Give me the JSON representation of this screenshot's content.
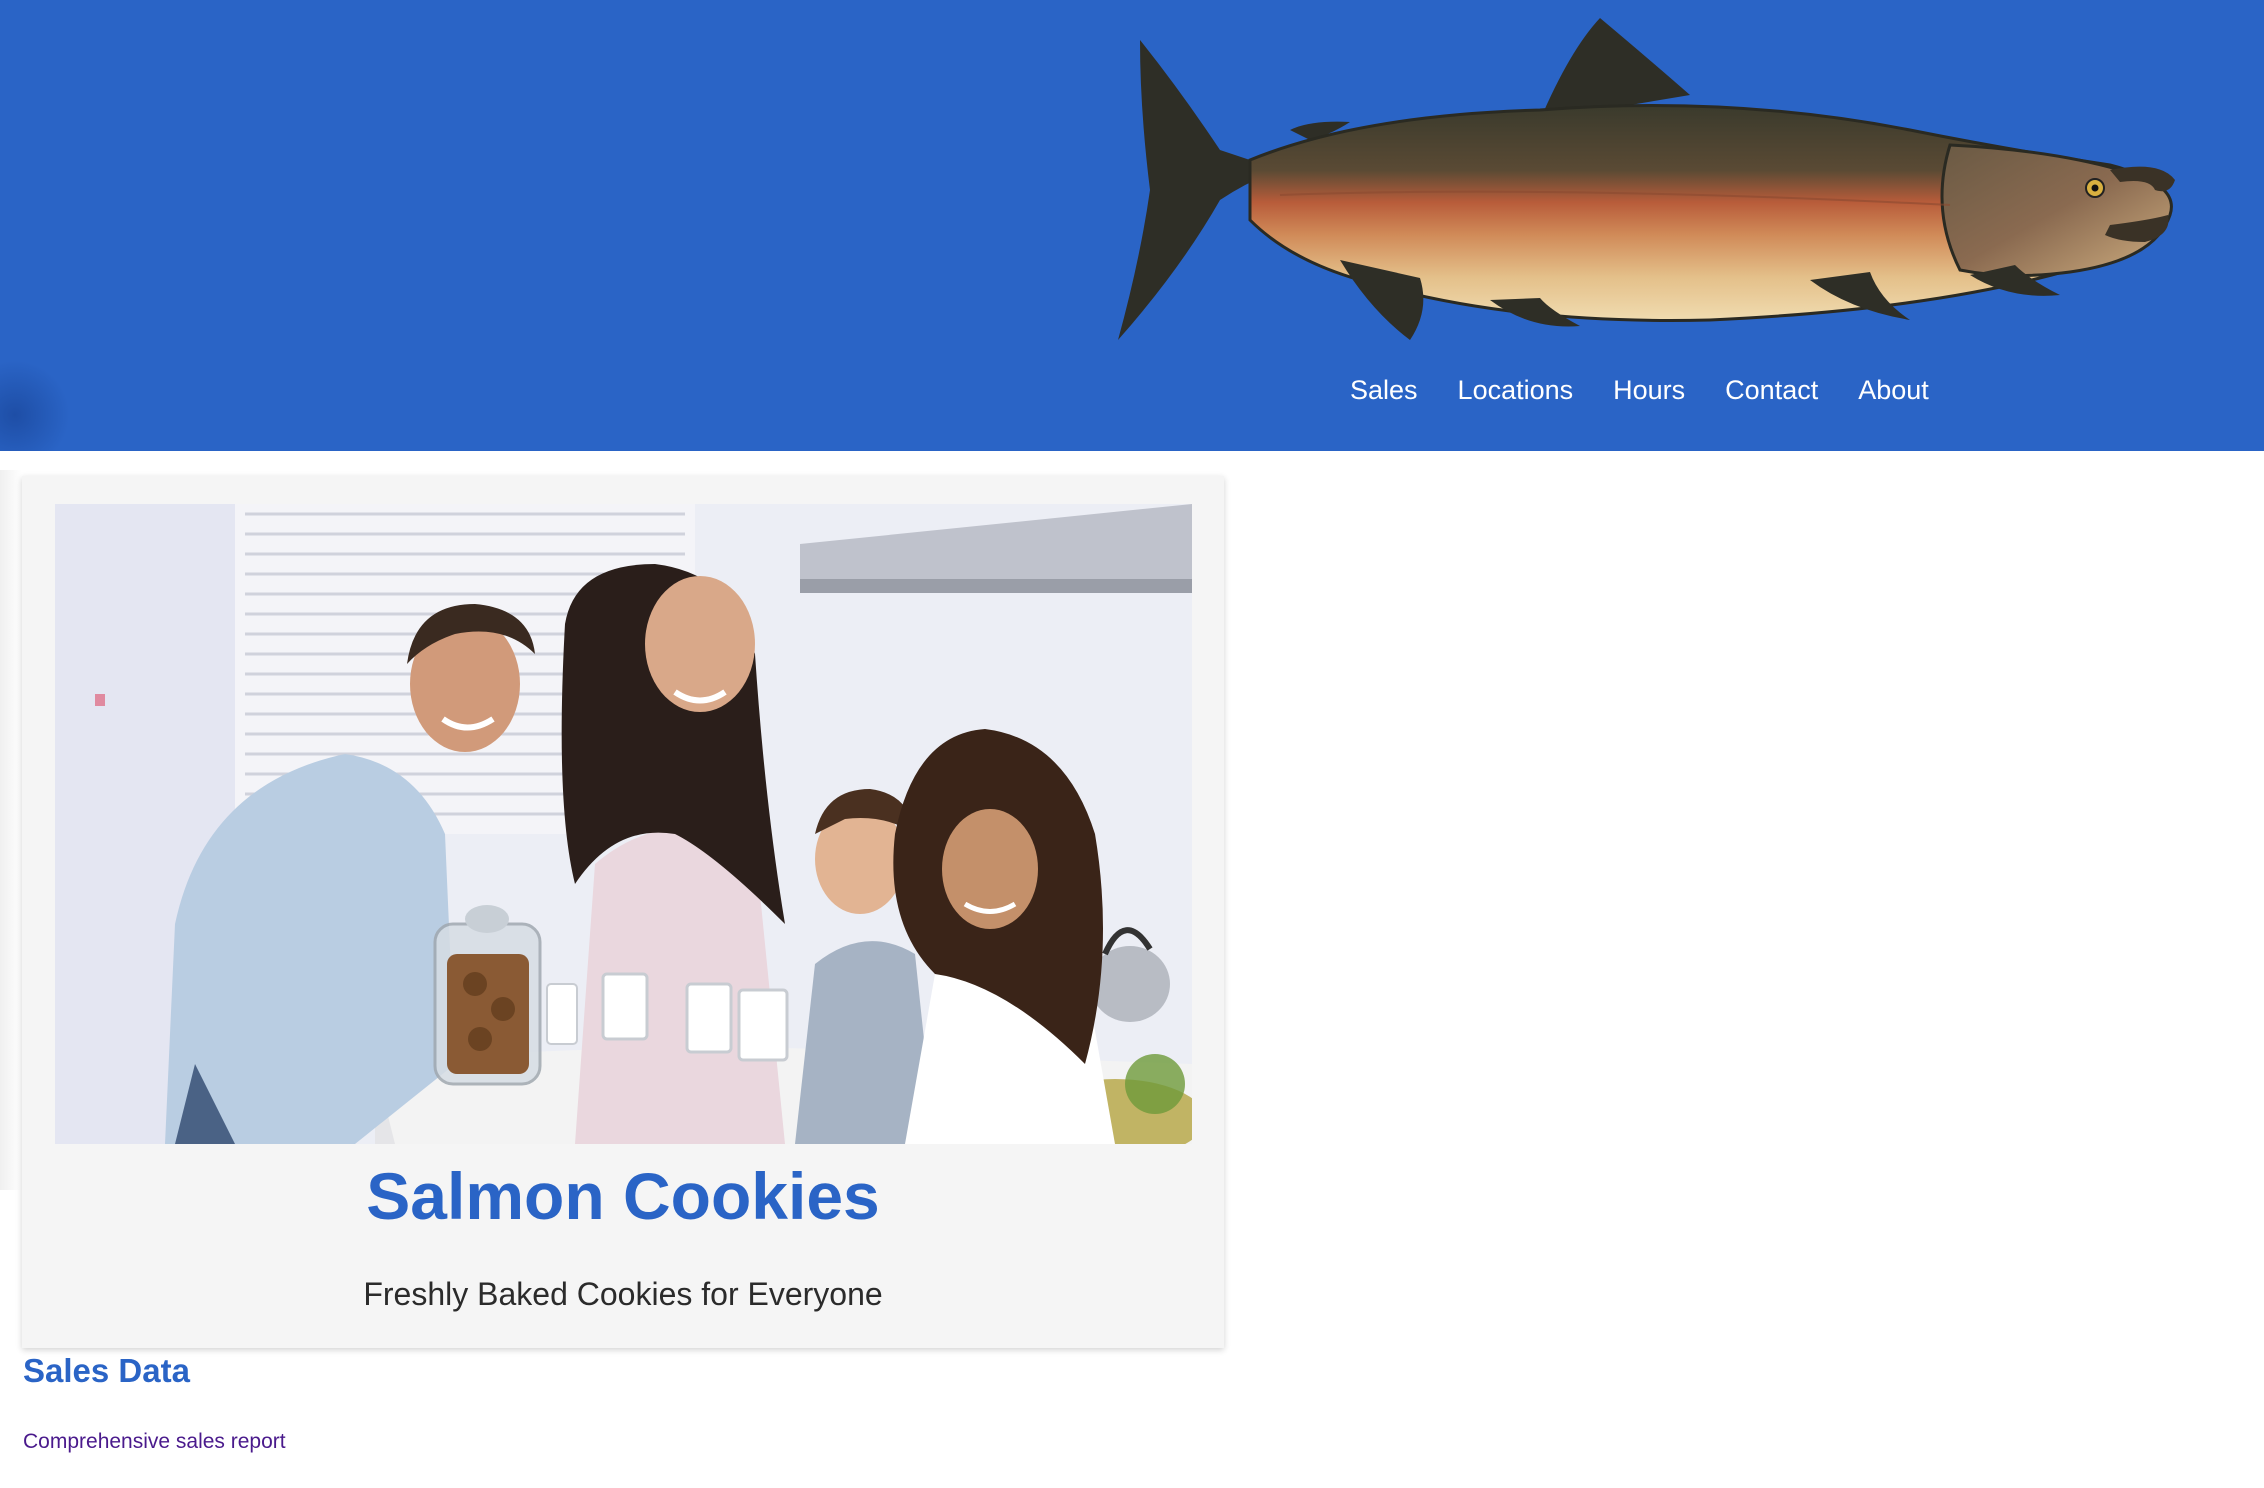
{
  "header": {
    "logo_icon": "salmon-fish-icon",
    "background_color": "#2a64c6",
    "nav": [
      {
        "label": "Sales"
      },
      {
        "label": "Locations"
      },
      {
        "label": "Hours"
      },
      {
        "label": "Contact"
      },
      {
        "label": "About"
      }
    ]
  },
  "hero": {
    "image_icon": "family-kitchen-photo",
    "title": "Salmon Cookies",
    "subtitle": "Freshly Baked Cookies for Everyone",
    "title_color": "#2a64c6"
  },
  "sales_section": {
    "title": "Sales Data",
    "link_text": "Comprehensive sales report",
    "link_color": "#4a1a8c"
  }
}
